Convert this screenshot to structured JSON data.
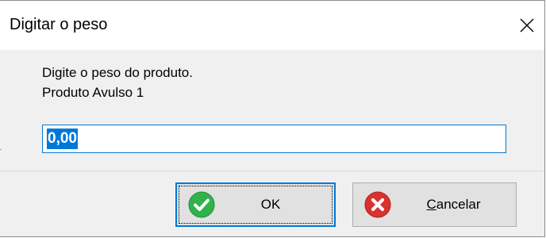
{
  "window": {
    "title": "Digitar o peso",
    "close_icon": "close-icon"
  },
  "prompt": {
    "line1": "Digite o peso do produto.",
    "line2": "Produto Avulso 1"
  },
  "weight_field": {
    "value": "0,00",
    "selected": true
  },
  "buttons": {
    "ok": {
      "label": "OK",
      "icon": "check-circle-icon",
      "icon_color": "#2fb34a",
      "default": true
    },
    "cancel": {
      "label_mnemonic": "C",
      "label_rest": "ancelar",
      "icon": "x-circle-icon",
      "icon_color": "#d9322f"
    }
  },
  "colors": {
    "accent": "#0078d7",
    "dialog_background": "#f0f0f0",
    "button_face": "#e1e1e1"
  }
}
